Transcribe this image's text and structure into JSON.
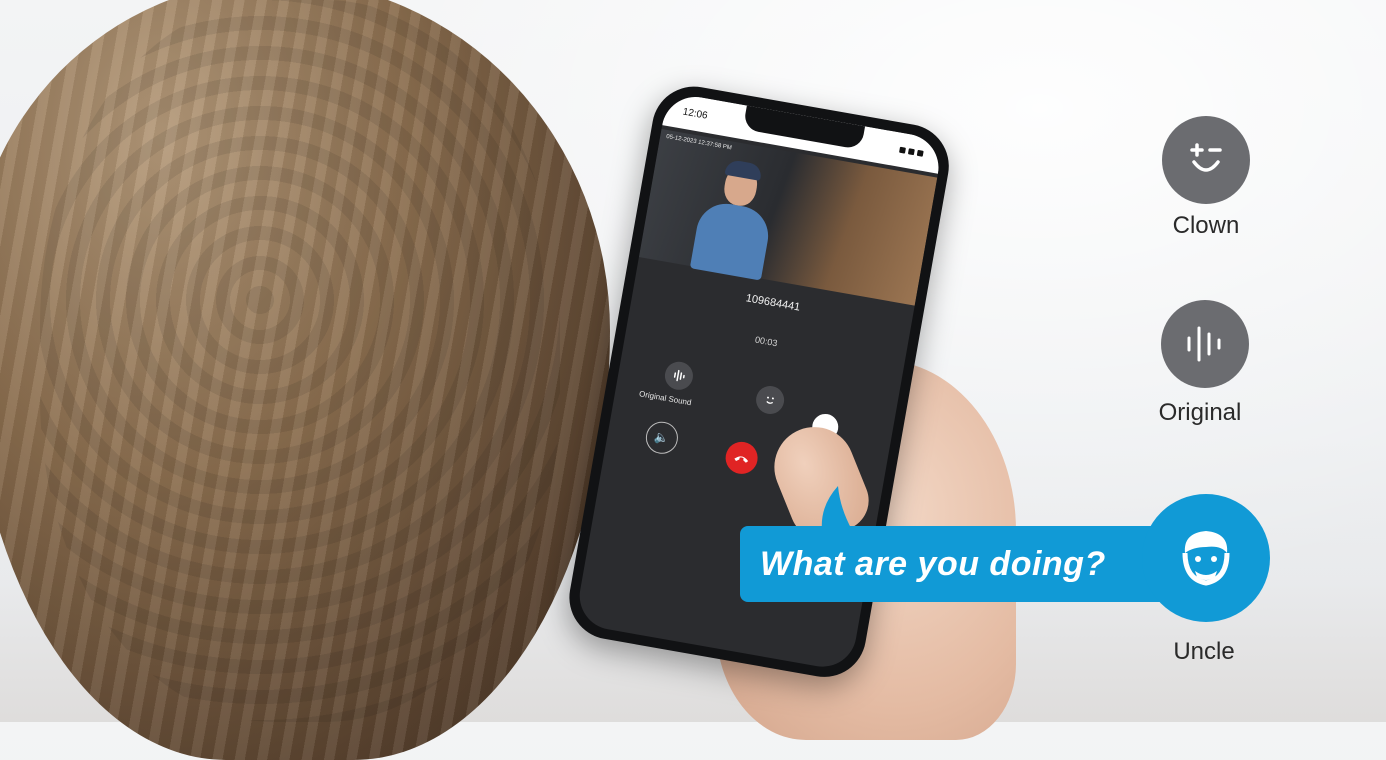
{
  "phone": {
    "status_time": "12:06",
    "video_timestamp": "05-12-2023 12:37:58 PM",
    "call_number": "109684441",
    "call_timer": "00:03",
    "original_sound_label": "Original Sound"
  },
  "speech_bubble": {
    "text": "What are you doing?"
  },
  "voice_options": {
    "clown": {
      "label": "Clown",
      "icon": "clown-face-icon"
    },
    "original": {
      "label": "Original",
      "icon": "sound-wave-icon"
    },
    "uncle": {
      "label": "Uncle",
      "icon": "uncle-face-icon"
    }
  },
  "colors": {
    "accent_blue": "#119ad6",
    "icon_gray": "#6b6c70",
    "hangup_red": "#e02424"
  }
}
